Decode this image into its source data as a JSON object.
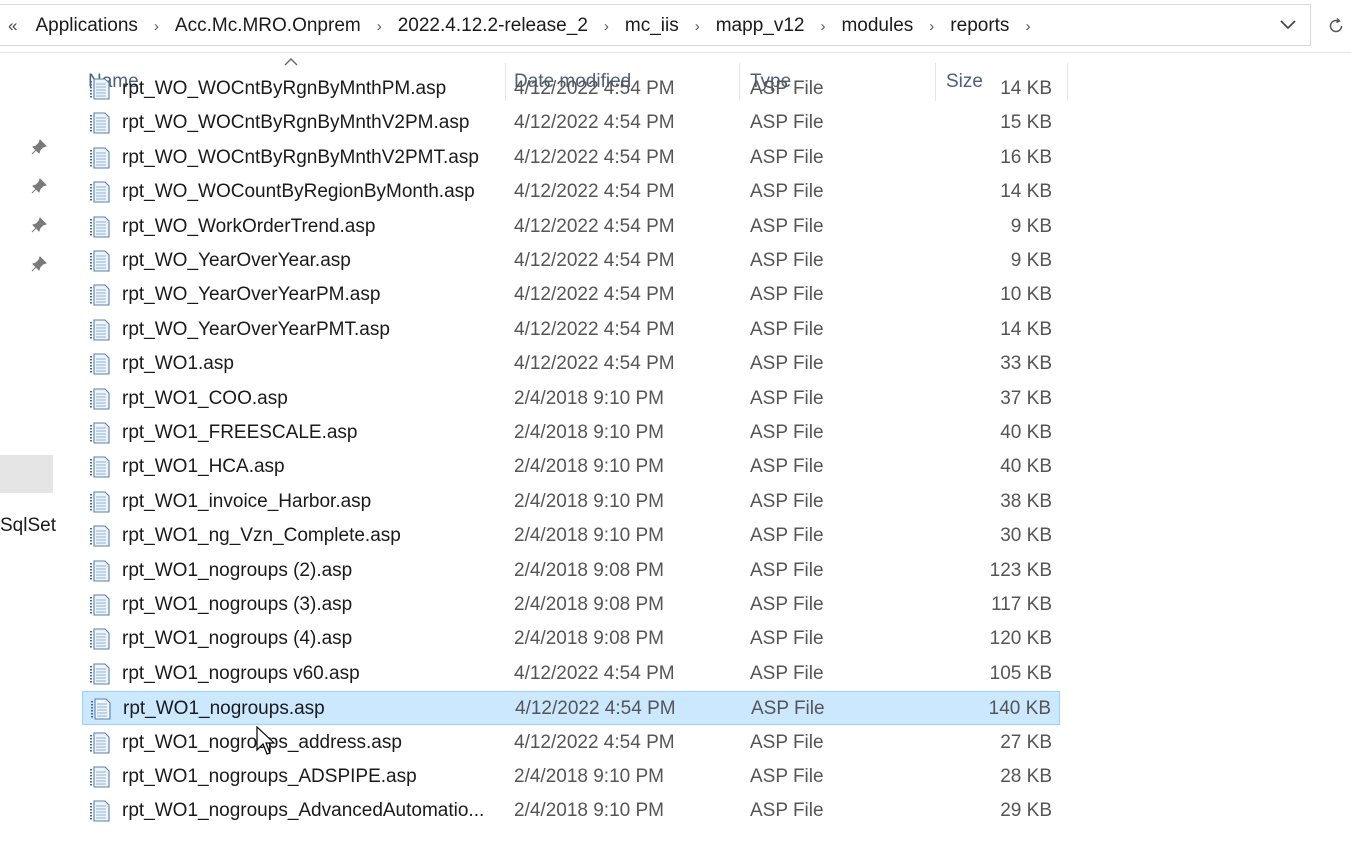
{
  "address": {
    "overflow": "«",
    "crumbs": [
      "Applications",
      "Acc.Mc.MRO.Onprem",
      "2022.4.12.2-release_2",
      "mc_iis",
      "mapp_v12",
      "modules",
      "reports"
    ]
  },
  "nav": {
    "label": "SqlSet"
  },
  "columns": {
    "name": "Name",
    "date": "Date modified",
    "type": "Type",
    "size": "Size"
  },
  "files": [
    {
      "name": "rpt_WO_WOCntByRgnByMnthPM.asp",
      "date": "4/12/2022 4:54 PM",
      "type": "ASP File",
      "size": "14 KB"
    },
    {
      "name": "rpt_WO_WOCntByRgnByMnthV2PM.asp",
      "date": "4/12/2022 4:54 PM",
      "type": "ASP File",
      "size": "15 KB"
    },
    {
      "name": "rpt_WO_WOCntByRgnByMnthV2PMT.asp",
      "date": "4/12/2022 4:54 PM",
      "type": "ASP File",
      "size": "16 KB"
    },
    {
      "name": "rpt_WO_WOCountByRegionByMonth.asp",
      "date": "4/12/2022 4:54 PM",
      "type": "ASP File",
      "size": "14 KB"
    },
    {
      "name": "rpt_WO_WorkOrderTrend.asp",
      "date": "4/12/2022 4:54 PM",
      "type": "ASP File",
      "size": "9 KB"
    },
    {
      "name": "rpt_WO_YearOverYear.asp",
      "date": "4/12/2022 4:54 PM",
      "type": "ASP File",
      "size": "9 KB"
    },
    {
      "name": "rpt_WO_YearOverYearPM.asp",
      "date": "4/12/2022 4:54 PM",
      "type": "ASP File",
      "size": "10 KB"
    },
    {
      "name": "rpt_WO_YearOverYearPMT.asp",
      "date": "4/12/2022 4:54 PM",
      "type": "ASP File",
      "size": "14 KB"
    },
    {
      "name": "rpt_WO1.asp",
      "date": "4/12/2022 4:54 PM",
      "type": "ASP File",
      "size": "33 KB"
    },
    {
      "name": "rpt_WO1_COO.asp",
      "date": "2/4/2018 9:10 PM",
      "type": "ASP File",
      "size": "37 KB"
    },
    {
      "name": "rpt_WO1_FREESCALE.asp",
      "date": "2/4/2018 9:10 PM",
      "type": "ASP File",
      "size": "40 KB"
    },
    {
      "name": "rpt_WO1_HCA.asp",
      "date": "2/4/2018 9:10 PM",
      "type": "ASP File",
      "size": "40 KB"
    },
    {
      "name": "rpt_WO1_invoice_Harbor.asp",
      "date": "2/4/2018 9:10 PM",
      "type": "ASP File",
      "size": "38 KB"
    },
    {
      "name": "rpt_WO1_ng_Vzn_Complete.asp",
      "date": "2/4/2018 9:10 PM",
      "type": "ASP File",
      "size": "30 KB"
    },
    {
      "name": "rpt_WO1_nogroups (2).asp",
      "date": "2/4/2018 9:08 PM",
      "type": "ASP File",
      "size": "123 KB"
    },
    {
      "name": "rpt_WO1_nogroups (3).asp",
      "date": "2/4/2018 9:08 PM",
      "type": "ASP File",
      "size": "117 KB"
    },
    {
      "name": "rpt_WO1_nogroups (4).asp",
      "date": "2/4/2018 9:08 PM",
      "type": "ASP File",
      "size": "120 KB"
    },
    {
      "name": "rpt_WO1_nogroups v60.asp",
      "date": "4/12/2022 4:54 PM",
      "type": "ASP File",
      "size": "105 KB"
    },
    {
      "name": "rpt_WO1_nogroups.asp",
      "date": "4/12/2022 4:54 PM",
      "type": "ASP File",
      "size": "140 KB",
      "selected": true
    },
    {
      "name": "rpt_WO1_nogroups_address.asp",
      "date": "4/12/2022 4:54 PM",
      "type": "ASP File",
      "size": "27 KB"
    },
    {
      "name": "rpt_WO1_nogroups_ADSPIPE.asp",
      "date": "2/4/2018 9:10 PM",
      "type": "ASP File",
      "size": "28 KB"
    },
    {
      "name": "rpt_WO1_nogroups_AdvancedAutomatio...",
      "date": "2/4/2018 9:10 PM",
      "type": "ASP File",
      "size": "29 KB"
    }
  ],
  "colors": {
    "selection_bg": "#cce8ff",
    "selection_border": "#99d1ff",
    "header_text": "#4c607a"
  }
}
